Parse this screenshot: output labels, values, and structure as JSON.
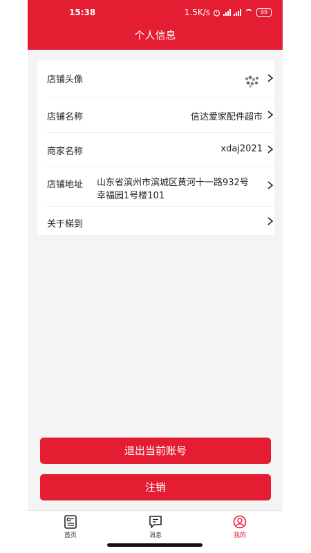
{
  "status_bar": {
    "time": "15:38",
    "speed": "1.5K/s",
    "battery": "99"
  },
  "header": {
    "title": "个人信息"
  },
  "info_rows": [
    {
      "label": "店铺头像",
      "value": ""
    },
    {
      "label": "店铺名称",
      "value": "信达爱家配件超市"
    },
    {
      "label": "商家名称",
      "value": "xdaj2021"
    },
    {
      "label": "店铺地址",
      "value_line1": "山东省滨州市滨城区黄河十一路932号",
      "value_line2": "幸福园1号楼101"
    },
    {
      "label": "关于梯到",
      "value": ""
    }
  ],
  "buttons": {
    "logout": "退出当前账号",
    "cancel_account": "注销"
  },
  "tabbar": {
    "items": [
      {
        "label": "首页",
        "icon": "home-icon",
        "active": false
      },
      {
        "label": "消息",
        "icon": "message-icon",
        "active": false
      },
      {
        "label": "我的",
        "icon": "user-icon",
        "active": true
      }
    ]
  },
  "colors": {
    "accent": "#e41d33",
    "background": "#f4f4f4",
    "card": "#ffffff"
  }
}
